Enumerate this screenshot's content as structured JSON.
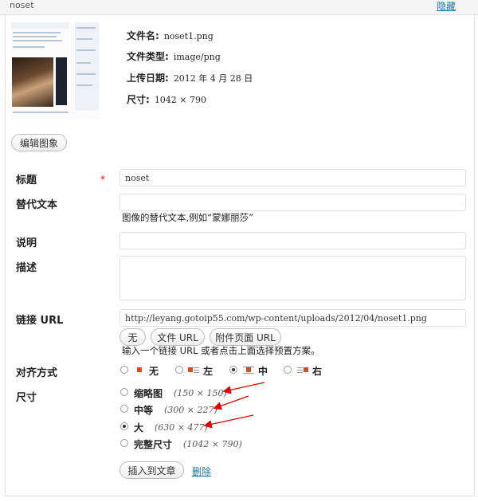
{
  "header": {
    "filename": "noset",
    "hide_link": "隐藏"
  },
  "file_info": {
    "name_label": "文件名:",
    "name_value": "noset1.png",
    "type_label": "文件类型:",
    "type_value": "image/png",
    "date_label": "上传日期:",
    "date_value": "2012 年 4 月 28 日",
    "size_label": "尺寸:",
    "size_value": "1042 × 790"
  },
  "edit_image_button": "编辑图象",
  "form": {
    "title_label": "标题",
    "title_value": "noset",
    "required_mark": "*",
    "alt_label": "替代文本",
    "alt_value": "",
    "alt_hint": "图像的替代文本,例如“蒙娜丽莎”",
    "caption_label": "说明",
    "caption_value": "",
    "desc_label": "描述",
    "desc_value": "",
    "link_label": "链接 URL",
    "link_value": "http://leyang.gotoip55.com/wp-content/uploads/2012/04/noset1.png",
    "link_buttons": [
      "无",
      "文件 URL",
      "附件页面 URL"
    ],
    "link_hint": "输入一个链接 URL 或者点击上面选择预置方案。",
    "align_label": "对齐方式",
    "align_options": [
      "无",
      "左",
      "中",
      "右"
    ],
    "align_selected": "中",
    "size_label": "尺寸",
    "size_options": [
      {
        "label": "缩略图",
        "dims": "(150 × 150)"
      },
      {
        "label": "中等",
        "dims": "(300 × 227)"
      },
      {
        "label": "大",
        "dims": "(630 × 477)"
      },
      {
        "label": "完整尺寸",
        "dims": "(1042 × 790)"
      }
    ],
    "size_selected": "大"
  },
  "actions": {
    "insert_button": "插入到文章",
    "delete_link": "删除"
  },
  "colors": {
    "link": "#21759b",
    "required": "#ee0000",
    "arrow": "#e00000",
    "align_icon": "#d54e21"
  }
}
